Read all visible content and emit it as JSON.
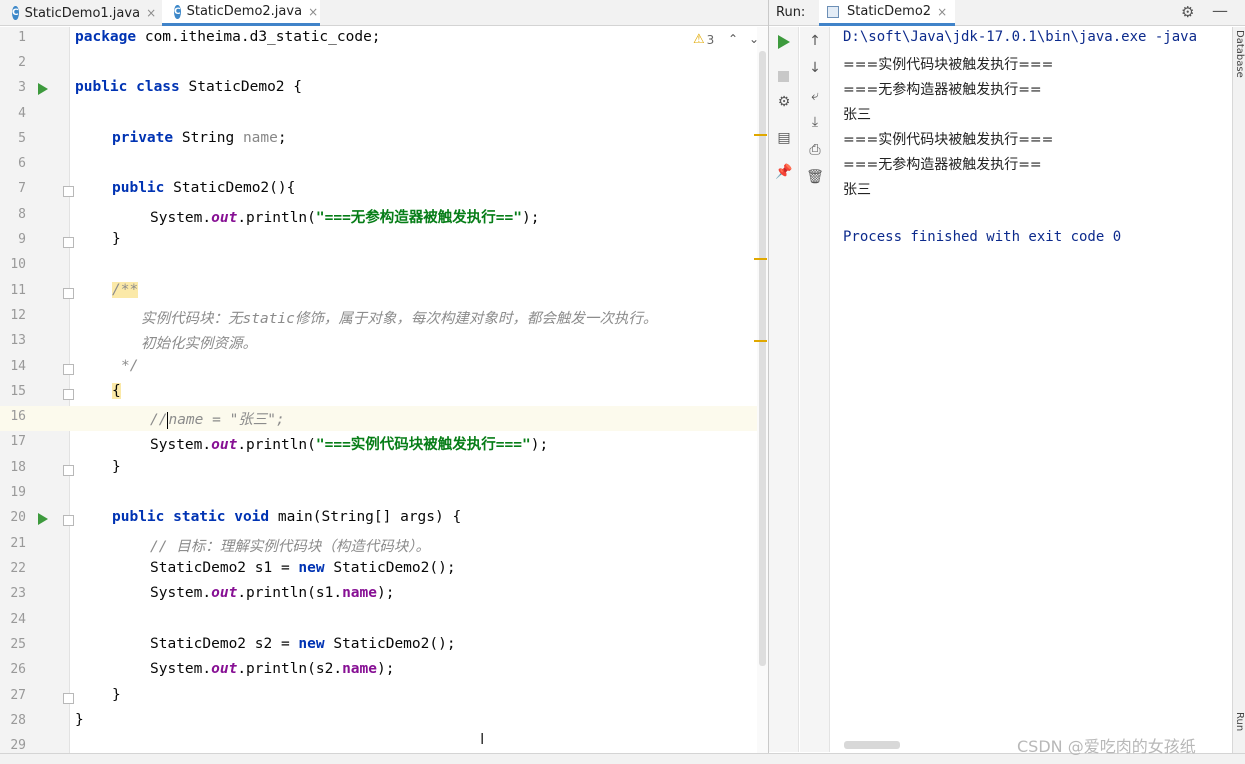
{
  "editor": {
    "tabs": [
      {
        "label": "StaticDemo1.java",
        "close": "×"
      },
      {
        "label": "StaticDemo2.java",
        "close": "×"
      }
    ],
    "tab_icon_letter": "C",
    "warning_count": "3",
    "lines": [
      {
        "n": "1"
      },
      {
        "n": "2"
      },
      {
        "n": "3"
      },
      {
        "n": "4"
      },
      {
        "n": "5"
      },
      {
        "n": "6"
      },
      {
        "n": "7"
      },
      {
        "n": "8"
      },
      {
        "n": "9"
      },
      {
        "n": "10"
      },
      {
        "n": "11"
      },
      {
        "n": "12"
      },
      {
        "n": "13"
      },
      {
        "n": "14"
      },
      {
        "n": "15"
      },
      {
        "n": "16"
      },
      {
        "n": "17"
      },
      {
        "n": "18"
      },
      {
        "n": "19"
      },
      {
        "n": "20"
      },
      {
        "n": "21"
      },
      {
        "n": "22"
      },
      {
        "n": "23"
      },
      {
        "n": "24"
      },
      {
        "n": "25"
      },
      {
        "n": "26"
      },
      {
        "n": "27"
      },
      {
        "n": "28"
      },
      {
        "n": "29"
      }
    ],
    "code": {
      "l1_kw": "package",
      "l1_rest": " com.itheima.d3_static_code;",
      "l3_kw": "public class",
      "l3_rest": " StaticDemo2 {",
      "l5_kw": "private",
      "l5_type": " String ",
      "l5_fld": "name",
      "l5_end": ";",
      "l7_kw": "public",
      "l7_rest": " StaticDemo2(){",
      "l8_a": "System.",
      "l8_sf": "out",
      "l8_b": ".println(",
      "l8_str": "\"===无参构造器被触发执行==\"",
      "l8_end": ");",
      "l9": "}",
      "l11": "/**",
      "l12": "实例代码块：无static修饰，属于对象，每次构建对象时，都会触发一次执行。",
      "l13": "初始化实例资源。",
      "l14": "*/",
      "l15": "{",
      "l16_a": "//",
      "l16_b": "name = \"张三\";",
      "l17_a": "System.",
      "l17_sf": "out",
      "l17_b": ".println(",
      "l17_str": "\"===实例代码块被触发执行===\"",
      "l17_end": ");",
      "l18": "}",
      "l20_kw": "public static void",
      "l20_rest": " main(String[] args) {",
      "l21": "// 目标：理解实例代码块（构造代码块）。",
      "l22_a": "StaticDemo2 s1 = ",
      "l22_kw": "new",
      "l22_b": " StaticDemo2();",
      "l23_a": "System.",
      "l23_sf": "out",
      "l23_b": ".println(s1.",
      "l23_fld": "name",
      "l23_end": ");",
      "l25_a": "StaticDemo2 s2 = ",
      "l25_kw": "new",
      "l25_b": " StaticDemo2();",
      "l26_a": "System.",
      "l26_sf": "out",
      "l26_b": ".println(s2.",
      "l26_fld": "name",
      "l26_end": ");",
      "l27": "}",
      "l28": "}"
    }
  },
  "run": {
    "label": "Run:",
    "tab": "StaticDemo2",
    "tab_close": "×",
    "console": [
      "D:\\soft\\Java\\jdk-17.0.1\\bin\\java.exe -java",
      "===实例代码块被触发执行===",
      "===无参构造器被触发执行==",
      "张三",
      "===实例代码块被触发执行===",
      "===无参构造器被触发执行==",
      "张三",
      "",
      "Process finished with exit code 0"
    ],
    "side_top": "Database",
    "side_bottom": "Run"
  },
  "watermark": "CSDN @爱吃肉的女孩纸",
  "colors": {
    "keyword": "#0033b3",
    "string": "#067d17",
    "field": "#871094",
    "comment": "#8c8c8c",
    "console_text": "#0c2a8c",
    "run_green": "#3d9a3d",
    "tab_accent": "#4083c9",
    "warning": "#e0a800"
  }
}
